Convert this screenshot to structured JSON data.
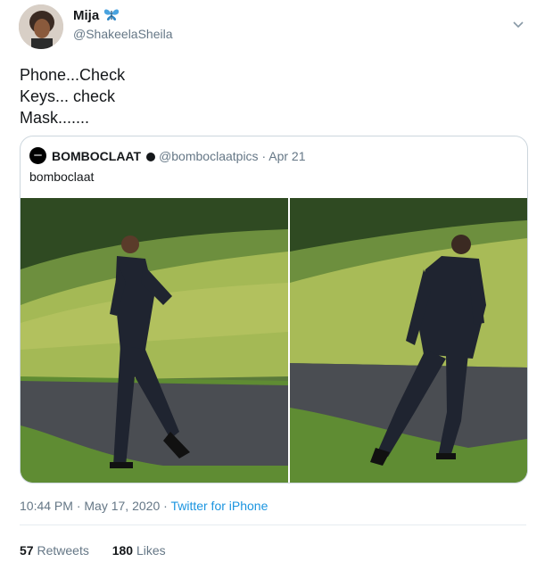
{
  "author": {
    "display_name": "Mija",
    "handle": "@ShakeelaSheila",
    "emoji_icon": "butterfly-icon"
  },
  "tweet": {
    "lines": [
      "Phone...Check",
      "Keys... check",
      "Mask......."
    ]
  },
  "quoted_tweet": {
    "display_name": "BOMBOCLAAT",
    "handle": "@bomboclaatpics",
    "separator": "·",
    "date": "Apr 21",
    "text": "bomboclaat"
  },
  "meta": {
    "time": "10:44 PM",
    "separator": "·",
    "date": "May 17, 2020",
    "separator2": "·",
    "source": "Twitter for iPhone"
  },
  "stats": {
    "retweets_count": "57",
    "retweets_label": "Retweets",
    "likes_count": "180",
    "likes_label": "Likes"
  },
  "colors": {
    "link": "#1b95e0",
    "muted": "#657786",
    "border": "#ccd6dd"
  }
}
